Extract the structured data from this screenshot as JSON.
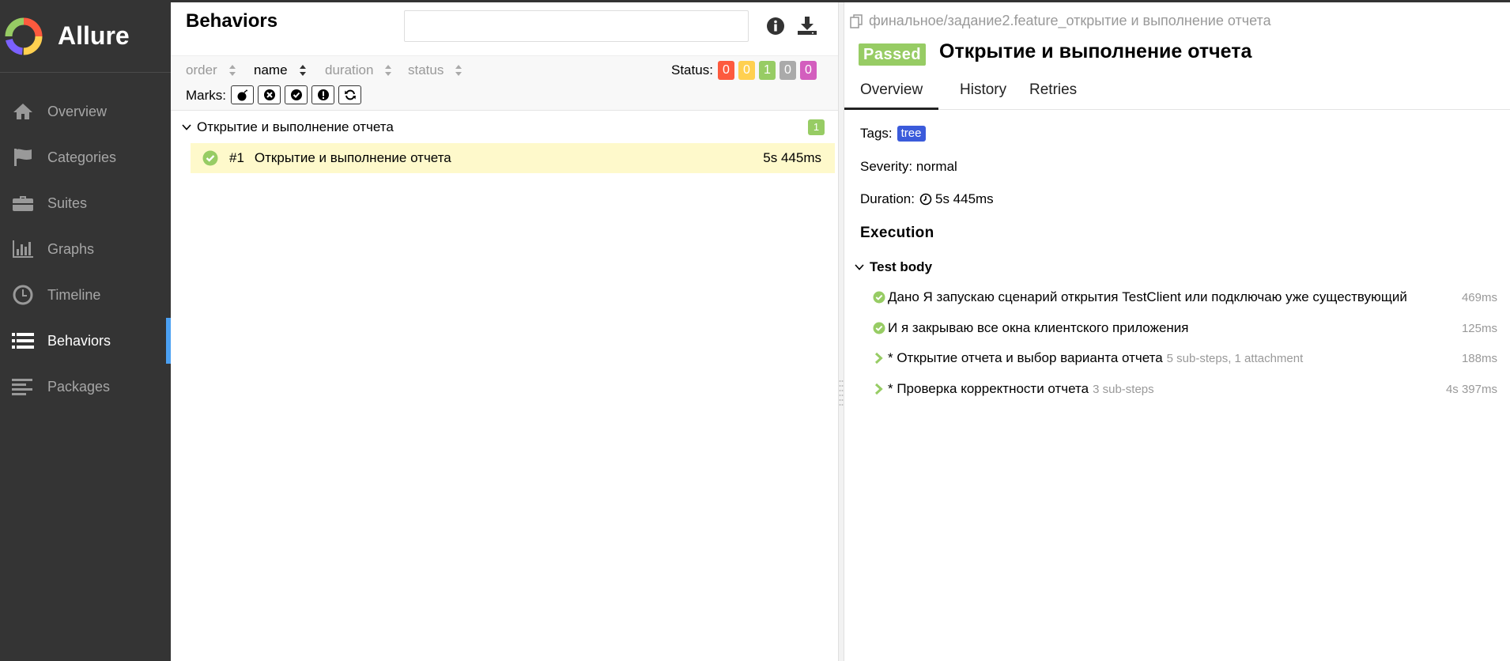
{
  "brand": {
    "name": "Allure"
  },
  "sidebar": {
    "items": [
      {
        "label": "Overview",
        "icon": "home-icon",
        "active": false
      },
      {
        "label": "Categories",
        "icon": "flag-icon",
        "active": false
      },
      {
        "label": "Suites",
        "icon": "briefcase-icon",
        "active": false
      },
      {
        "label": "Graphs",
        "icon": "bar-chart-icon",
        "active": false
      },
      {
        "label": "Timeline",
        "icon": "clock-icon",
        "active": false
      },
      {
        "label": "Behaviors",
        "icon": "list-icon",
        "active": true
      },
      {
        "label": "Packages",
        "icon": "align-left-icon",
        "active": false
      }
    ]
  },
  "behaviors": {
    "title": "Behaviors",
    "search": {
      "value": "",
      "placeholder": ""
    },
    "sort": {
      "order": "order",
      "name": "name",
      "duration": "duration",
      "status": "status"
    },
    "status_label": "Status:",
    "status_counts": [
      {
        "status": "failed",
        "count": "0",
        "color": "#fd5a3e"
      },
      {
        "status": "broken",
        "count": "0",
        "color": "#ffd050"
      },
      {
        "status": "passed",
        "count": "1",
        "color": "#97cc64"
      },
      {
        "status": "skipped",
        "count": "0",
        "color": "#aaaaaa"
      },
      {
        "status": "unknown",
        "count": "0",
        "color": "#d35ebe"
      }
    ],
    "marks_label": "Marks:",
    "marks": [
      "flaky-bomb-icon",
      "new-failed-icon",
      "new-passed-icon",
      "new-broken-icon",
      "retries-icon"
    ],
    "group": {
      "name": "Открытие и выполнение отчета",
      "count": "1"
    },
    "test": {
      "number": "#1",
      "name": "Открытие и выполнение отчета",
      "duration": "5s 445ms"
    }
  },
  "detail": {
    "path": "финальное/задание2.feature_открытие и выполнение отчета",
    "status": "Passed",
    "title": "Открытие и выполнение отчета",
    "tabs": [
      "Overview",
      "History",
      "Retries"
    ],
    "tags_label": "Tags:",
    "tag": "tree",
    "severity": "Severity: normal",
    "duration_label": "Duration:",
    "duration": "5s 445ms",
    "execution_title": "Execution",
    "test_body": "Test body",
    "steps": [
      {
        "name": "Дано Я запускаю сценарий открытия TestClient или подключаю уже существующий",
        "sub": "",
        "duration": "469ms",
        "kind": "passed"
      },
      {
        "name": "И я закрываю все окна клиентского приложения",
        "sub": "",
        "duration": "125ms",
        "kind": "passed"
      },
      {
        "name": "* Открытие отчета и выбор варианта отчета",
        "sub": "5 sub-steps, 1 attachment",
        "duration": "188ms",
        "kind": "expand"
      },
      {
        "name": "* Проверка корректности отчета",
        "sub": "3 sub-steps",
        "duration": "4s 397ms",
        "kind": "expand"
      }
    ]
  }
}
